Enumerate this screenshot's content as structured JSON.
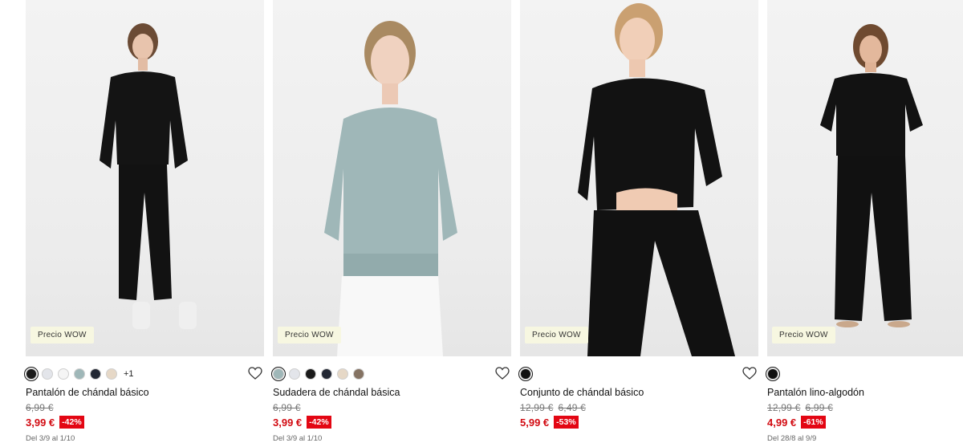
{
  "products": [
    {
      "badge": "Precio WOW",
      "swatches": [
        "#1b1b1b",
        "#e3e5ea",
        "#f5f5f5",
        "#9fb7b8",
        "#232834",
        "#e6d8c7"
      ],
      "more": "+1",
      "name": "Pantalón de chándal básico",
      "old_price": "6,99 €",
      "old_price_2": "",
      "price": "3,99 €",
      "discount": "-42%",
      "dates": "Del 3/9 al 1/10"
    },
    {
      "badge": "Precio WOW",
      "swatches": [
        "#9fb7b8",
        "#e3e5ea",
        "#1b1b1b",
        "#232834",
        "#e6d8c7",
        "#857363"
      ],
      "more": "",
      "name": "Sudadera de chándal básica",
      "old_price": "6,99 €",
      "old_price_2": "",
      "price": "3,99 €",
      "discount": "-42%",
      "dates": "Del 3/9 al 1/10"
    },
    {
      "badge": "Precio WOW",
      "swatches": [
        "#111111"
      ],
      "more": "",
      "name": "Conjunto de chándal básico",
      "old_price": "12,99 €",
      "old_price_2": "6,49 €",
      "price": "5,99 €",
      "discount": "-53%",
      "dates": ""
    },
    {
      "badge": "Precio WOW",
      "swatches": [
        "#111111"
      ],
      "more": "",
      "name": "Pantalón lino-algodón",
      "old_price": "12,99 €",
      "old_price_2": "6,99 €",
      "price": "4,99 €",
      "discount": "-61%",
      "dates": "Del 28/8 al 9/9"
    }
  ],
  "icons": {
    "favorite": "heart-outline-icon"
  },
  "colors": {
    "sale_red": "#d20a11",
    "badge_bg": "#f7f7e1"
  }
}
